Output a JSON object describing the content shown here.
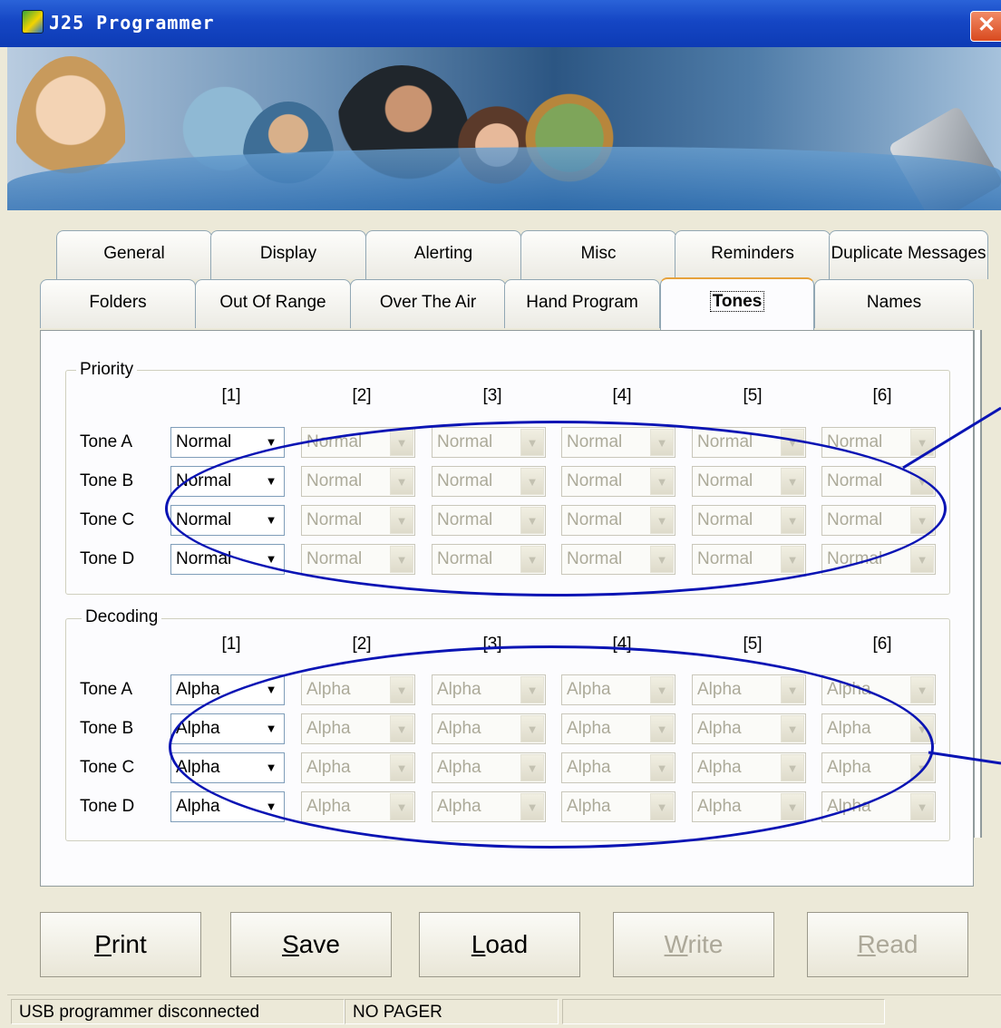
{
  "window": {
    "title": "J25 Programmer",
    "close_glyph": "✕"
  },
  "tabs": {
    "row1": [
      "General",
      "Display",
      "Alerting",
      "Misc",
      "Reminders",
      "Duplicate Messages"
    ],
    "row2": [
      "Folders",
      "Out Of Range",
      "Over The Air",
      "Hand Program",
      "Tones",
      "Names"
    ],
    "active": "Tones"
  },
  "priority": {
    "title": "Priority",
    "columns": [
      "[1]",
      "[2]",
      "[3]",
      "[4]",
      "[5]",
      "[6]"
    ],
    "rows": [
      {
        "label": "Tone A",
        "values": [
          "Normal",
          "Normal",
          "Normal",
          "Normal",
          "Normal",
          "Normal"
        ]
      },
      {
        "label": "Tone B",
        "values": [
          "Normal",
          "Normal",
          "Normal",
          "Normal",
          "Normal",
          "Normal"
        ]
      },
      {
        "label": "Tone C",
        "values": [
          "Normal",
          "Normal",
          "Normal",
          "Normal",
          "Normal",
          "Normal"
        ]
      },
      {
        "label": "Tone D",
        "values": [
          "Normal",
          "Normal",
          "Normal",
          "Normal",
          "Normal",
          "Normal"
        ]
      }
    ]
  },
  "decoding": {
    "title": "Decoding",
    "columns": [
      "[1]",
      "[2]",
      "[3]",
      "[4]",
      "[5]",
      "[6]"
    ],
    "rows": [
      {
        "label": "Tone A",
        "values": [
          "Alpha",
          "Alpha",
          "Alpha",
          "Alpha",
          "Alpha",
          "Alpha"
        ]
      },
      {
        "label": "Tone B",
        "values": [
          "Alpha",
          "Alpha",
          "Alpha",
          "Alpha",
          "Alpha",
          "Alpha"
        ]
      },
      {
        "label": "Tone C",
        "values": [
          "Alpha",
          "Alpha",
          "Alpha",
          "Alpha",
          "Alpha",
          "Alpha"
        ]
      },
      {
        "label": "Tone D",
        "values": [
          "Alpha",
          "Alpha",
          "Alpha",
          "Alpha",
          "Alpha",
          "Alpha"
        ]
      }
    ]
  },
  "buttons": [
    {
      "label": "Print",
      "accel": "P",
      "rest": "rint",
      "enabled": true
    },
    {
      "label": "Save",
      "accel": "S",
      "rest": "ave",
      "enabled": true
    },
    {
      "label": "Load",
      "accel": "L",
      "rest": "oad",
      "enabled": true
    },
    {
      "label": "Write",
      "accel": "W",
      "rest": "rite",
      "enabled": false
    },
    {
      "label": "Read",
      "accel": "R",
      "rest": "ead",
      "enabled": false
    }
  ],
  "status": {
    "connection": "USB programmer disconnected",
    "pager": "NO PAGER",
    "extra": ""
  },
  "colors": {
    "annotation": "#0a14b4",
    "titlebar": "#1546c4",
    "tab_highlight": "#e6a23c"
  }
}
